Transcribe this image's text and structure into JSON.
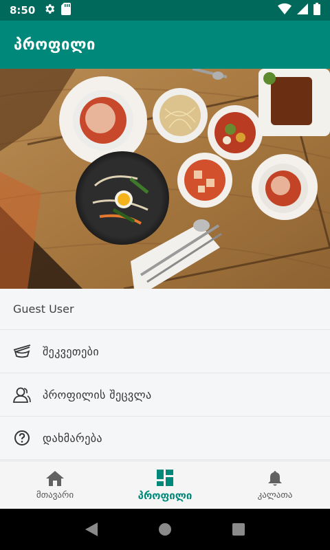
{
  "status_bar": {
    "time": "8:50",
    "icons": [
      "settings-icon",
      "sd-card-icon",
      "wifi-icon",
      "signal-icon",
      "battery-icon"
    ]
  },
  "app_bar": {
    "title": "პროფილი",
    "color": "#00897b"
  },
  "hero": {
    "icon": "food-photo"
  },
  "menu": {
    "header": "Guest User",
    "items": [
      {
        "label": "შეკვეთები",
        "icon": "chopsticks-icon"
      },
      {
        "label": "პროფილის შეცვლა",
        "icon": "user-icon"
      },
      {
        "label": "დახმარება",
        "icon": "help-icon"
      }
    ]
  },
  "bottom_nav": {
    "items": [
      {
        "label": "მთავარი",
        "icon": "home-icon",
        "active": false
      },
      {
        "label": "პროფილი",
        "icon": "dashboard-icon",
        "active": true
      },
      {
        "label": "კალათა",
        "icon": "bell-icon",
        "active": false
      }
    ],
    "active_color": "#00897b"
  },
  "system_nav": {
    "icons": [
      "back-icon",
      "home-circle-icon",
      "recents-icon"
    ]
  }
}
